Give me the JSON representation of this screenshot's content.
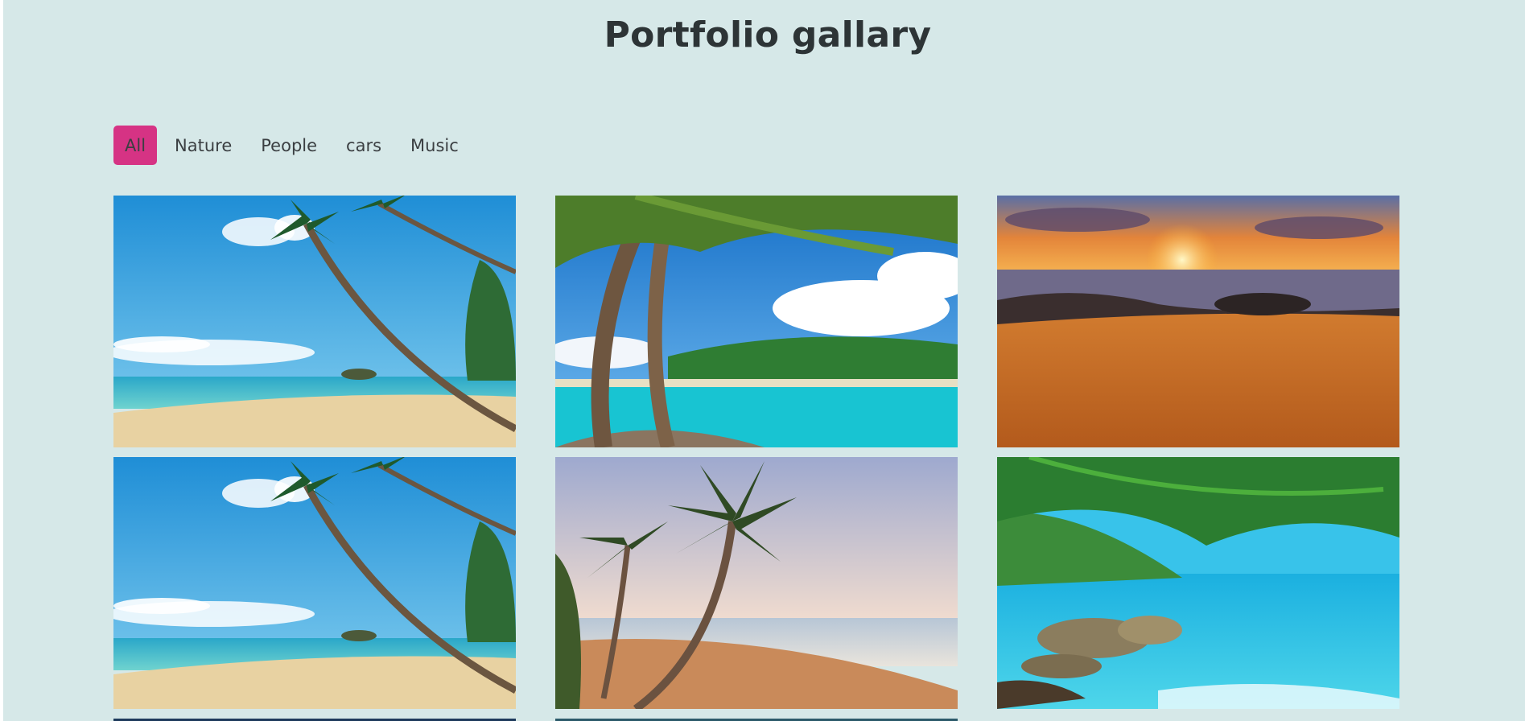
{
  "header": {
    "title": "Portfolio gallary"
  },
  "filters": [
    {
      "label": "All",
      "active": true
    },
    {
      "label": "Nature",
      "active": false
    },
    {
      "label": "People",
      "active": false
    },
    {
      "label": "cars",
      "active": false
    },
    {
      "label": "Music",
      "active": false
    }
  ],
  "colors": {
    "background": "#d6e8e8",
    "active_filter": "#d63384",
    "title": "#2d3436"
  },
  "gallery": {
    "images": [
      {
        "subject": "tropical-beach-leaning-palm"
      },
      {
        "subject": "palm-trunks-turquoise-lagoon"
      },
      {
        "subject": "sunset-over-rocky-beach"
      },
      {
        "subject": "tropical-beach-leaning-palm"
      },
      {
        "subject": "palm-on-sandy-shore"
      },
      {
        "subject": "palm-frond-over-rocky-cove"
      },
      {
        "subject": "partial-image"
      },
      {
        "subject": "partial-image"
      }
    ]
  }
}
